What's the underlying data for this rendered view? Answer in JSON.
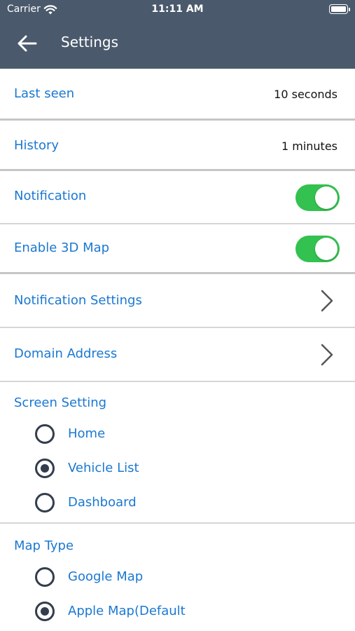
{
  "status_bar": {
    "carrier": "Carrier",
    "time": "11:11 AM"
  },
  "header": {
    "title": "Settings",
    "background": "#4a5a6c"
  },
  "settings": {
    "last_seen": {
      "label": "Last seen",
      "value": "10 seconds"
    },
    "history": {
      "label": "History",
      "value": "1 minutes"
    },
    "notification": {
      "label": "Notification",
      "enabled": true
    },
    "enable_3d_map": {
      "label": "Enable 3D Map",
      "enabled": true
    },
    "notification_settings": {
      "label": "Notification Settings"
    },
    "domain_address": {
      "label": "Domain Address"
    }
  },
  "screen_setting": {
    "title": "Screen Setting",
    "options": [
      {
        "label": "Home",
        "selected": false
      },
      {
        "label": "Vehicle List",
        "selected": true
      },
      {
        "label": "Dashboard",
        "selected": false
      }
    ]
  },
  "map_type": {
    "title": "Map Type",
    "options": [
      {
        "label": "Google Map",
        "selected": false
      },
      {
        "label": "Apple Map(Default",
        "selected": true
      }
    ]
  },
  "colors": {
    "label_blue": "#1a78d2",
    "toggle_green": "#33c14f",
    "radio_dark": "#333d4d"
  }
}
